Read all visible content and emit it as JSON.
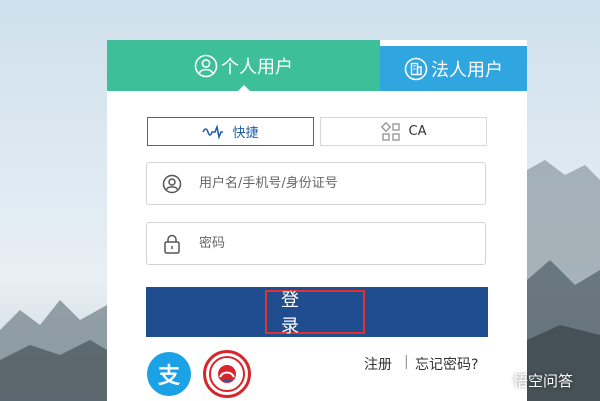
{
  "tabs": {
    "personal": {
      "label": "个人用户",
      "icon": "user-circle-icon"
    },
    "legal": {
      "label": "法人用户",
      "icon": "building-icon"
    }
  },
  "login_modes": {
    "quick": {
      "label": "快捷",
      "icon": "pulse-icon"
    },
    "ca": {
      "label": "CA",
      "icon": "ca-certificate-icon"
    }
  },
  "form": {
    "username_placeholder": "用户名/手机号/身份证号",
    "password_placeholder": "密码",
    "login_label": "登 录"
  },
  "footer": {
    "alipay_glyph": "支",
    "register_label": "注册",
    "separator": "|",
    "forgot_label": "忘记密码?"
  },
  "watermark": {
    "text": "悟空问答"
  },
  "colors": {
    "personal_tab": "#3dbf9a",
    "legal_tab": "#2fa6e0",
    "login_bar": "#1f4d8f",
    "highlight_border": "#e0322f",
    "alipay": "#1aa1e6"
  }
}
